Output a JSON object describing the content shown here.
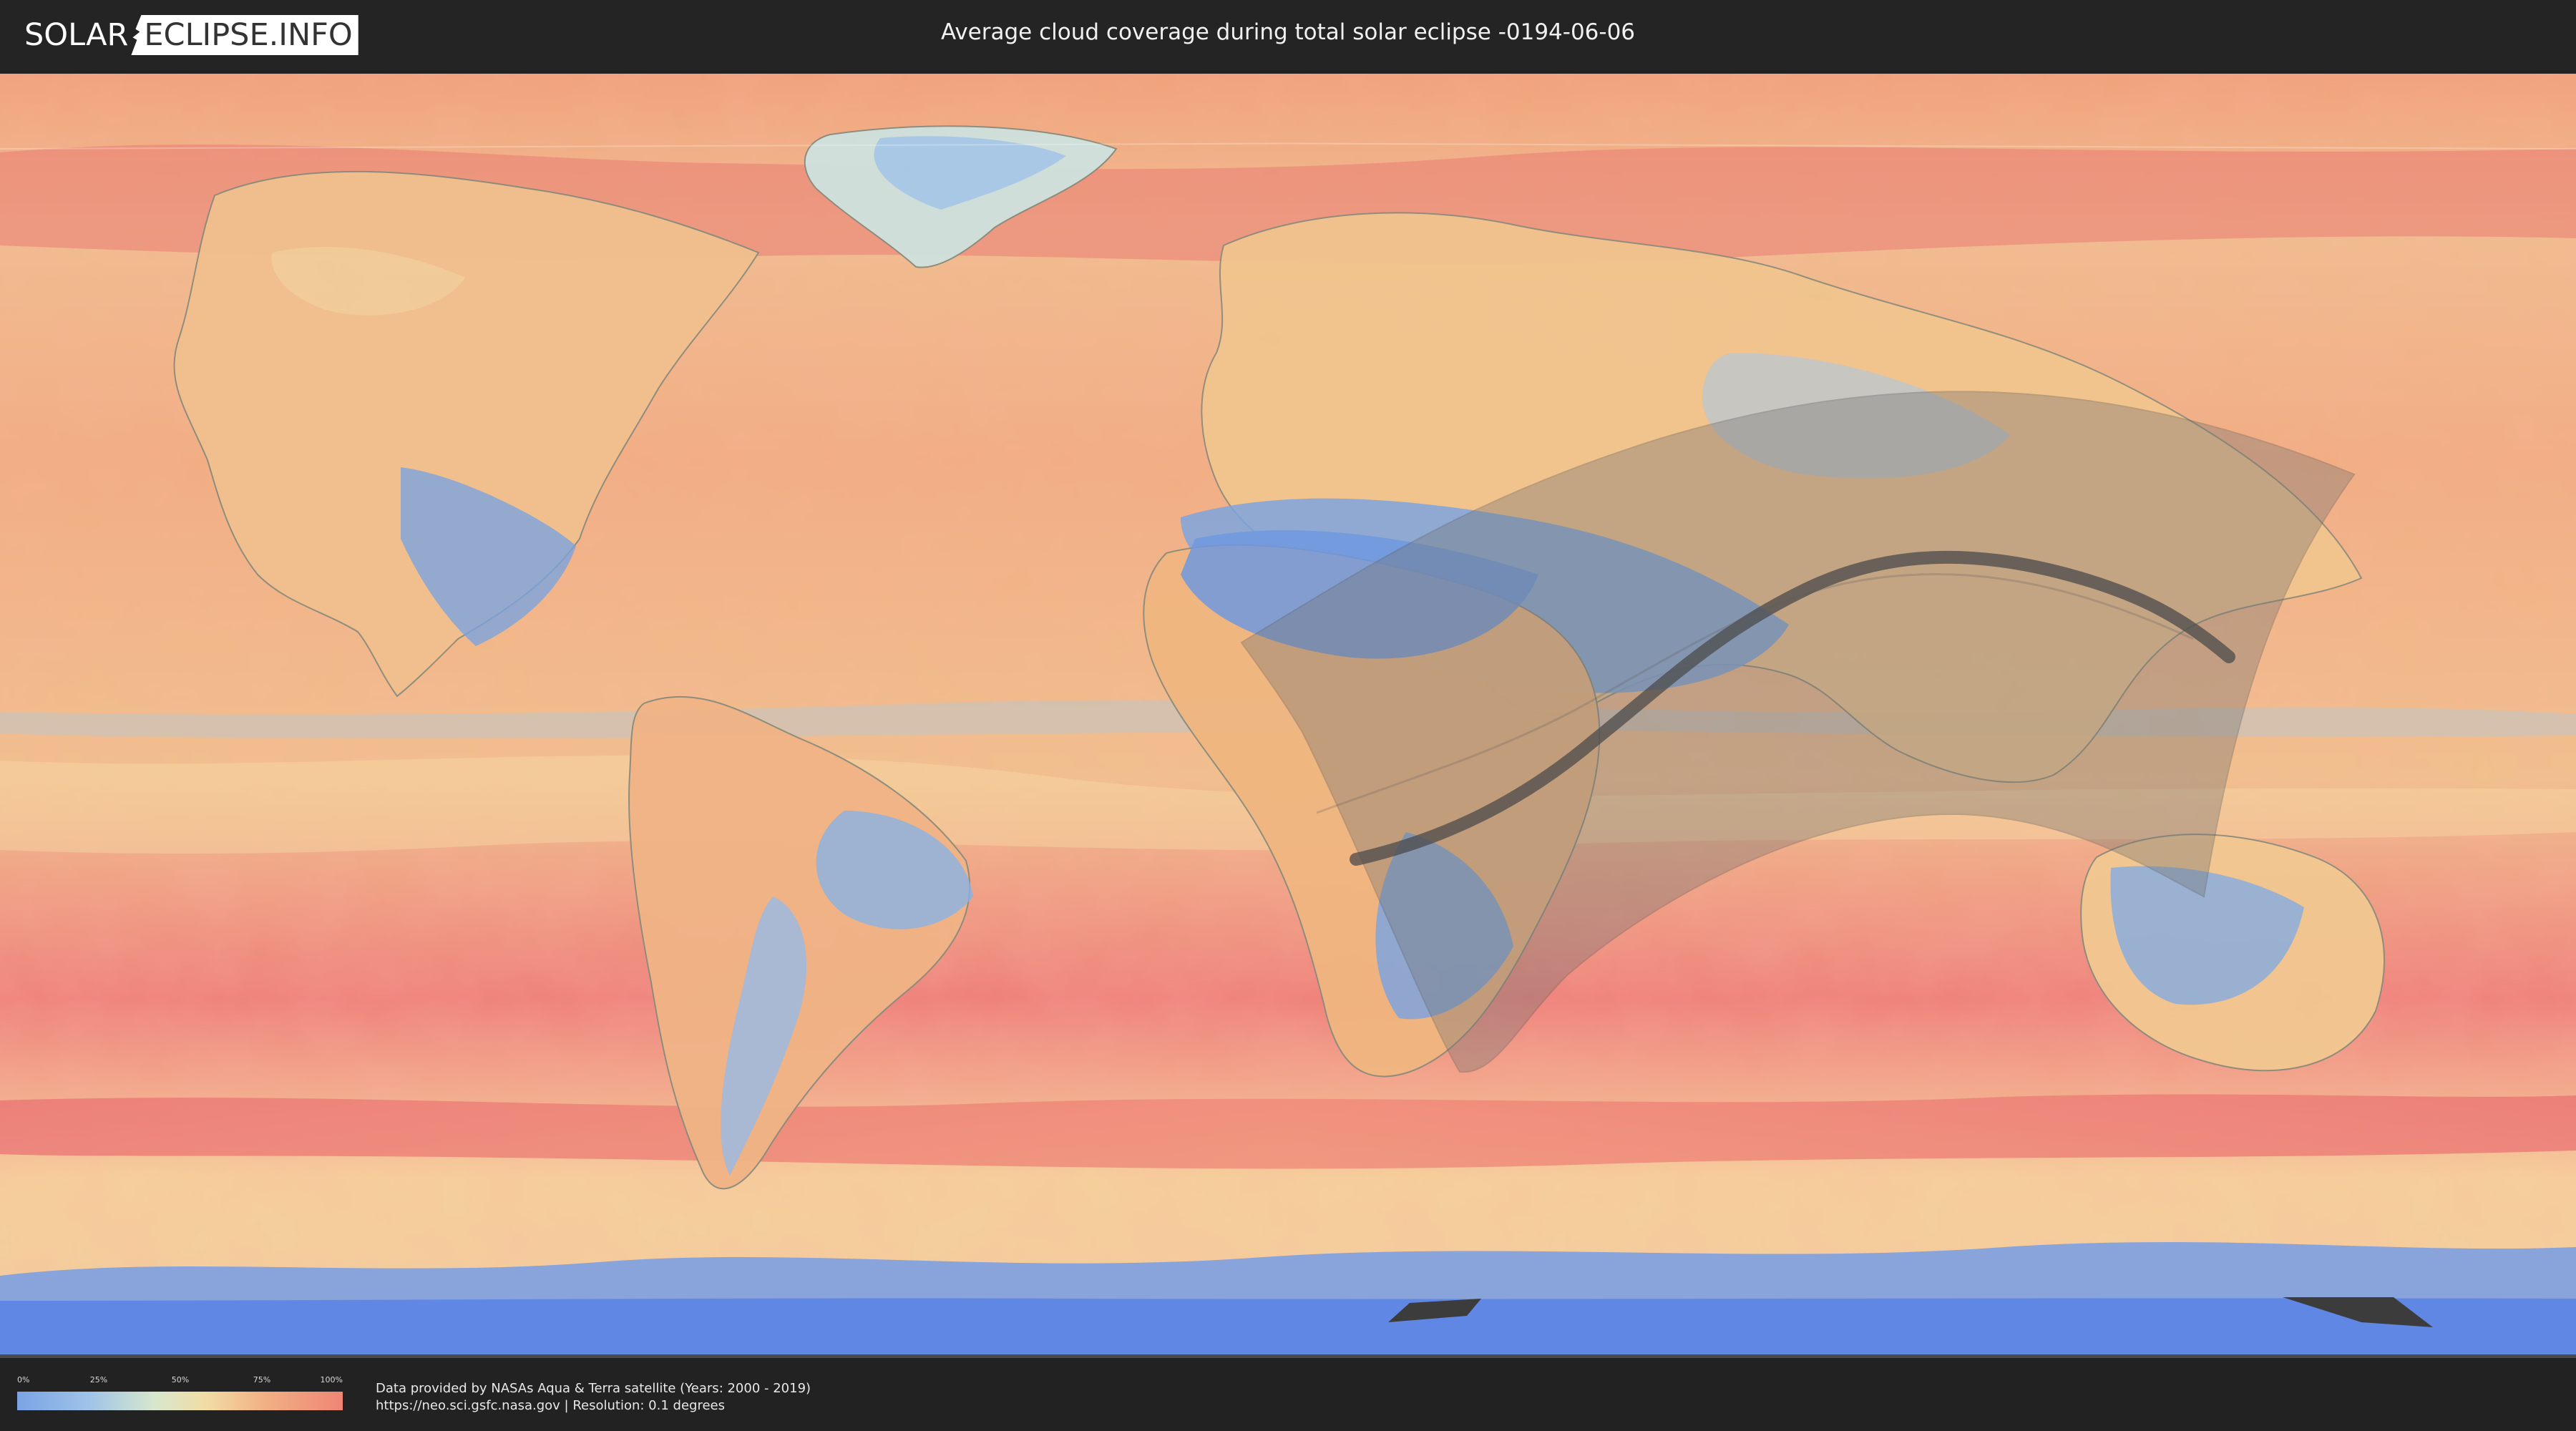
{
  "header": {
    "logo_left": "SOLAR",
    "logo_right": "ECLIPSE.INFO",
    "title": "Average cloud coverage during total solar eclipse -0194-06-06"
  },
  "legend": {
    "ticks": [
      "0%",
      "25%",
      "50%",
      "75%",
      "100%"
    ],
    "colors": [
      "#7aa3e5",
      "#9fc3e8",
      "#d6e7ce",
      "#f2dca4",
      "#f1b083",
      "#ef8575"
    ]
  },
  "source": {
    "line1": "Data provided by NASAs Aqua & Terra satellite (Years: 2000 - 2019)",
    "line2": "https://neo.sci.gsfc.nasa.gov | Resolution: 0.1 degrees"
  },
  "map": {
    "background_color": "#e8b18a",
    "clear_color": "#7ca5df",
    "cloudy_color": "#e96f74",
    "path_shadow_color": "#6f6f6f",
    "central_line_color": "#4b4b4b"
  }
}
